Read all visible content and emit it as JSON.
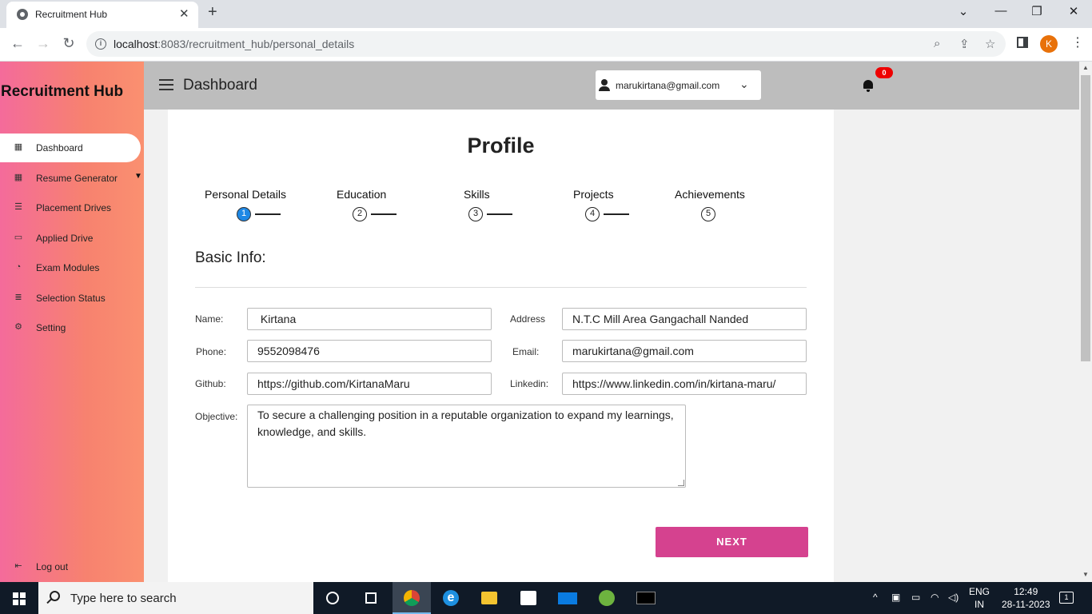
{
  "browser": {
    "tab_title": "Recruitment Hub",
    "url_host": "localhost",
    "url_rest": ":8083/recruitment_hub/personal_details",
    "profile_initial": "K"
  },
  "app": {
    "brand": "Recruitment Hub",
    "topbar_title": "Dashboard",
    "user_email": "marukirtana@gmail.com",
    "notification_count": "0"
  },
  "sidebar": {
    "items": [
      {
        "label": "Dashboard",
        "icon": "grid-icon"
      },
      {
        "label": "Resume Generator",
        "icon": "grid-icon"
      },
      {
        "label": "Placement Drives",
        "icon": "list-icon"
      },
      {
        "label": "Applied Drive",
        "icon": "chat-icon"
      },
      {
        "label": "Exam Modules",
        "icon": "pie-icon"
      },
      {
        "label": "Selection Status",
        "icon": "database-icon"
      },
      {
        "label": "Setting",
        "icon": "gear-icon"
      }
    ],
    "logout": "Log out"
  },
  "profile": {
    "title": "Profile",
    "steps": [
      {
        "label": "Personal Details",
        "number": "1"
      },
      {
        "label": "Education",
        "number": "2"
      },
      {
        "label": "Skills",
        "number": "3"
      },
      {
        "label": "Projects",
        "number": "4"
      },
      {
        "label": "Achievements",
        "number": "5"
      }
    ],
    "section_title": "Basic Info:",
    "fields": {
      "name_label": "Name:",
      "name_value": " Kirtana",
      "address_label": "Address",
      "address_value": "N.T.C Mill Area Gangachall Nanded",
      "phone_label": "Phone:",
      "phone_value": "9552098476",
      "email_label": "Email:",
      "email_value": "marukirtana@gmail.com",
      "github_label": "Github:",
      "github_value": "https://github.com/KirtanaMaru",
      "linkedin_label": "Linkedin:",
      "linkedin_value": "https://www.linkedin.com/in/kirtana-maru/",
      "objective_label": "Objective:",
      "objective_value": "To secure a challenging position in a reputable organization to expand my learnings, knowledge, and skills."
    },
    "next_button": "NEXT"
  },
  "taskbar": {
    "search_placeholder": "Type here to search",
    "lang_top": "ENG",
    "lang_bottom": "IN",
    "time": "12:49",
    "date": "28-11-2023",
    "notification_count": "1"
  },
  "colors": {
    "accent": "#d5428f",
    "active_step": "#1e88e5",
    "sidebar_gradient_start": "#f46b9b",
    "sidebar_gradient_end": "#fa9070"
  }
}
